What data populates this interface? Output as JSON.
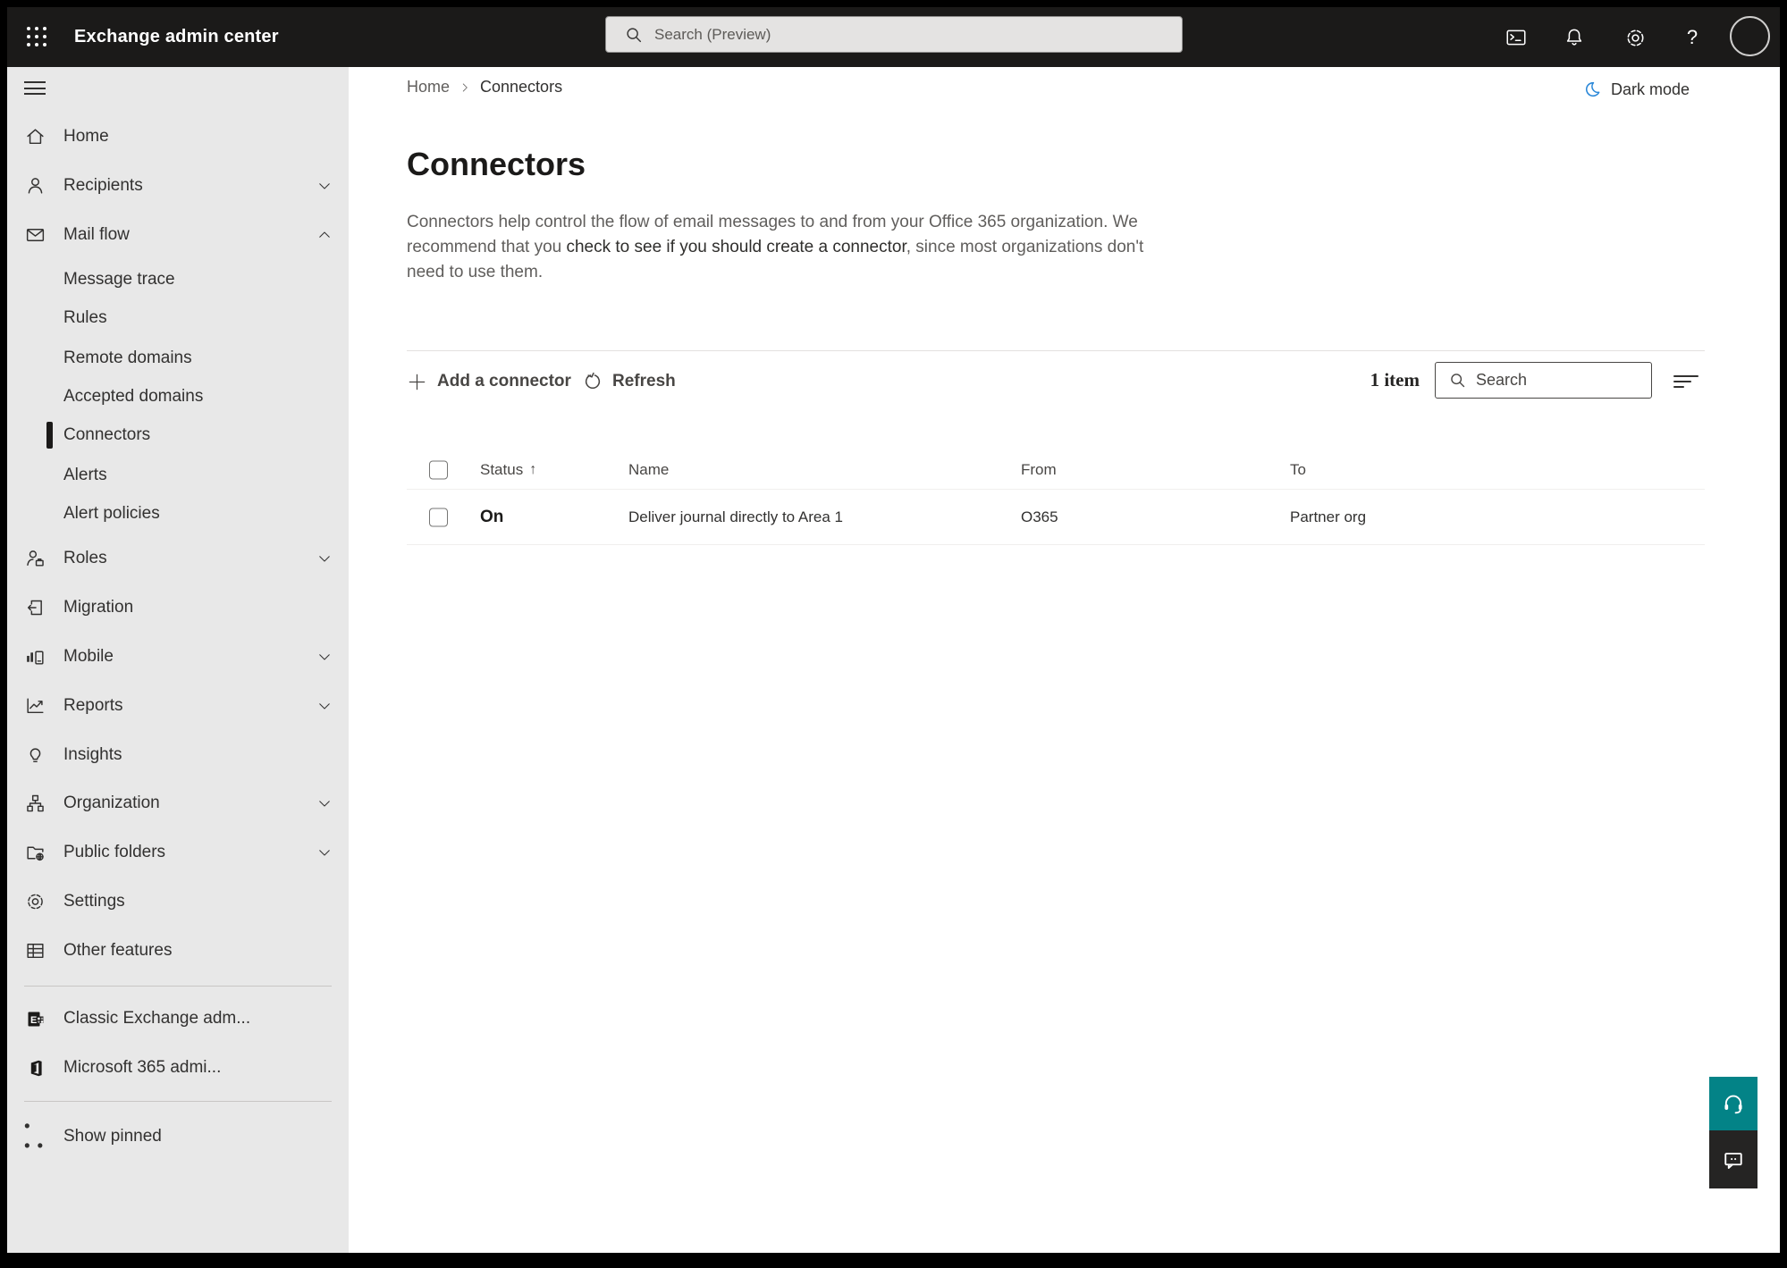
{
  "topbar": {
    "title": "Exchange admin center",
    "search_placeholder": "Search (Preview)",
    "help_label": "?",
    "icons": [
      "app-launcher",
      "cloud-shell",
      "notifications",
      "settings",
      "help",
      "account"
    ]
  },
  "sidebar": {
    "items": [
      {
        "label": "Home",
        "icon": "home"
      },
      {
        "label": "Recipients",
        "icon": "person",
        "chevron": "down"
      },
      {
        "label": "Mail flow",
        "icon": "mail",
        "chevron": "up",
        "expanded": true
      },
      {
        "label": "Message trace",
        "sub": true
      },
      {
        "label": "Rules",
        "sub": true
      },
      {
        "label": "Remote domains",
        "sub": true
      },
      {
        "label": "Accepted domains",
        "sub": true
      },
      {
        "label": "Connectors",
        "sub": true,
        "selected": true
      },
      {
        "label": "Alerts",
        "sub": true
      },
      {
        "label": "Alert policies",
        "sub": true
      },
      {
        "label": "Roles",
        "icon": "roles",
        "chevron": "down"
      },
      {
        "label": "Migration",
        "icon": "migration"
      },
      {
        "label": "Mobile",
        "icon": "mobile",
        "chevron": "down"
      },
      {
        "label": "Reports",
        "icon": "reports",
        "chevron": "down"
      },
      {
        "label": "Insights",
        "icon": "insights"
      },
      {
        "label": "Organization",
        "icon": "organization",
        "chevron": "down"
      },
      {
        "label": "Public folders",
        "icon": "public-folders",
        "chevron": "down"
      },
      {
        "label": "Settings",
        "icon": "gear"
      },
      {
        "label": "Other features",
        "icon": "table"
      }
    ],
    "footer_items": [
      {
        "label": "Classic Exchange adm...",
        "icon": "exchange-logo"
      },
      {
        "label": "Microsoft 365 admi...",
        "icon": "microsoft-365-logo"
      }
    ],
    "show_pinned": "Show pinned"
  },
  "breadcrumb": {
    "home": "Home",
    "current": "Connectors"
  },
  "dark_mode": {
    "label": "Dark mode"
  },
  "page": {
    "title": "Connectors",
    "desc_pre": "Connectors help control the flow of email messages to and from your Office 365 organization. We recommend that you ",
    "desc_link": "check to see if you should create a connector",
    "desc_post": ", since most organizations don't need to use them."
  },
  "toolbar": {
    "add_label": "Add a connector",
    "refresh_label": "Refresh",
    "item_count": "1 item",
    "search_placeholder": "Search"
  },
  "table": {
    "sort_indicator": "↑",
    "headers": {
      "status": "Status",
      "name": "Name",
      "from": "From",
      "to": "To"
    },
    "rows": [
      {
        "status": "On",
        "name": "Deliver journal directly to Area 1",
        "from": "O365",
        "to": "Partner org"
      }
    ]
  },
  "colors": {
    "topbar_bg": "#1b1a19",
    "sidebar_bg": "#e8e8e8",
    "selected_indicator": "#1b1a19",
    "dark_mode_accent": "#2b88d8",
    "help_button_teal": "#038387",
    "chat_button_dark": "#252423"
  }
}
